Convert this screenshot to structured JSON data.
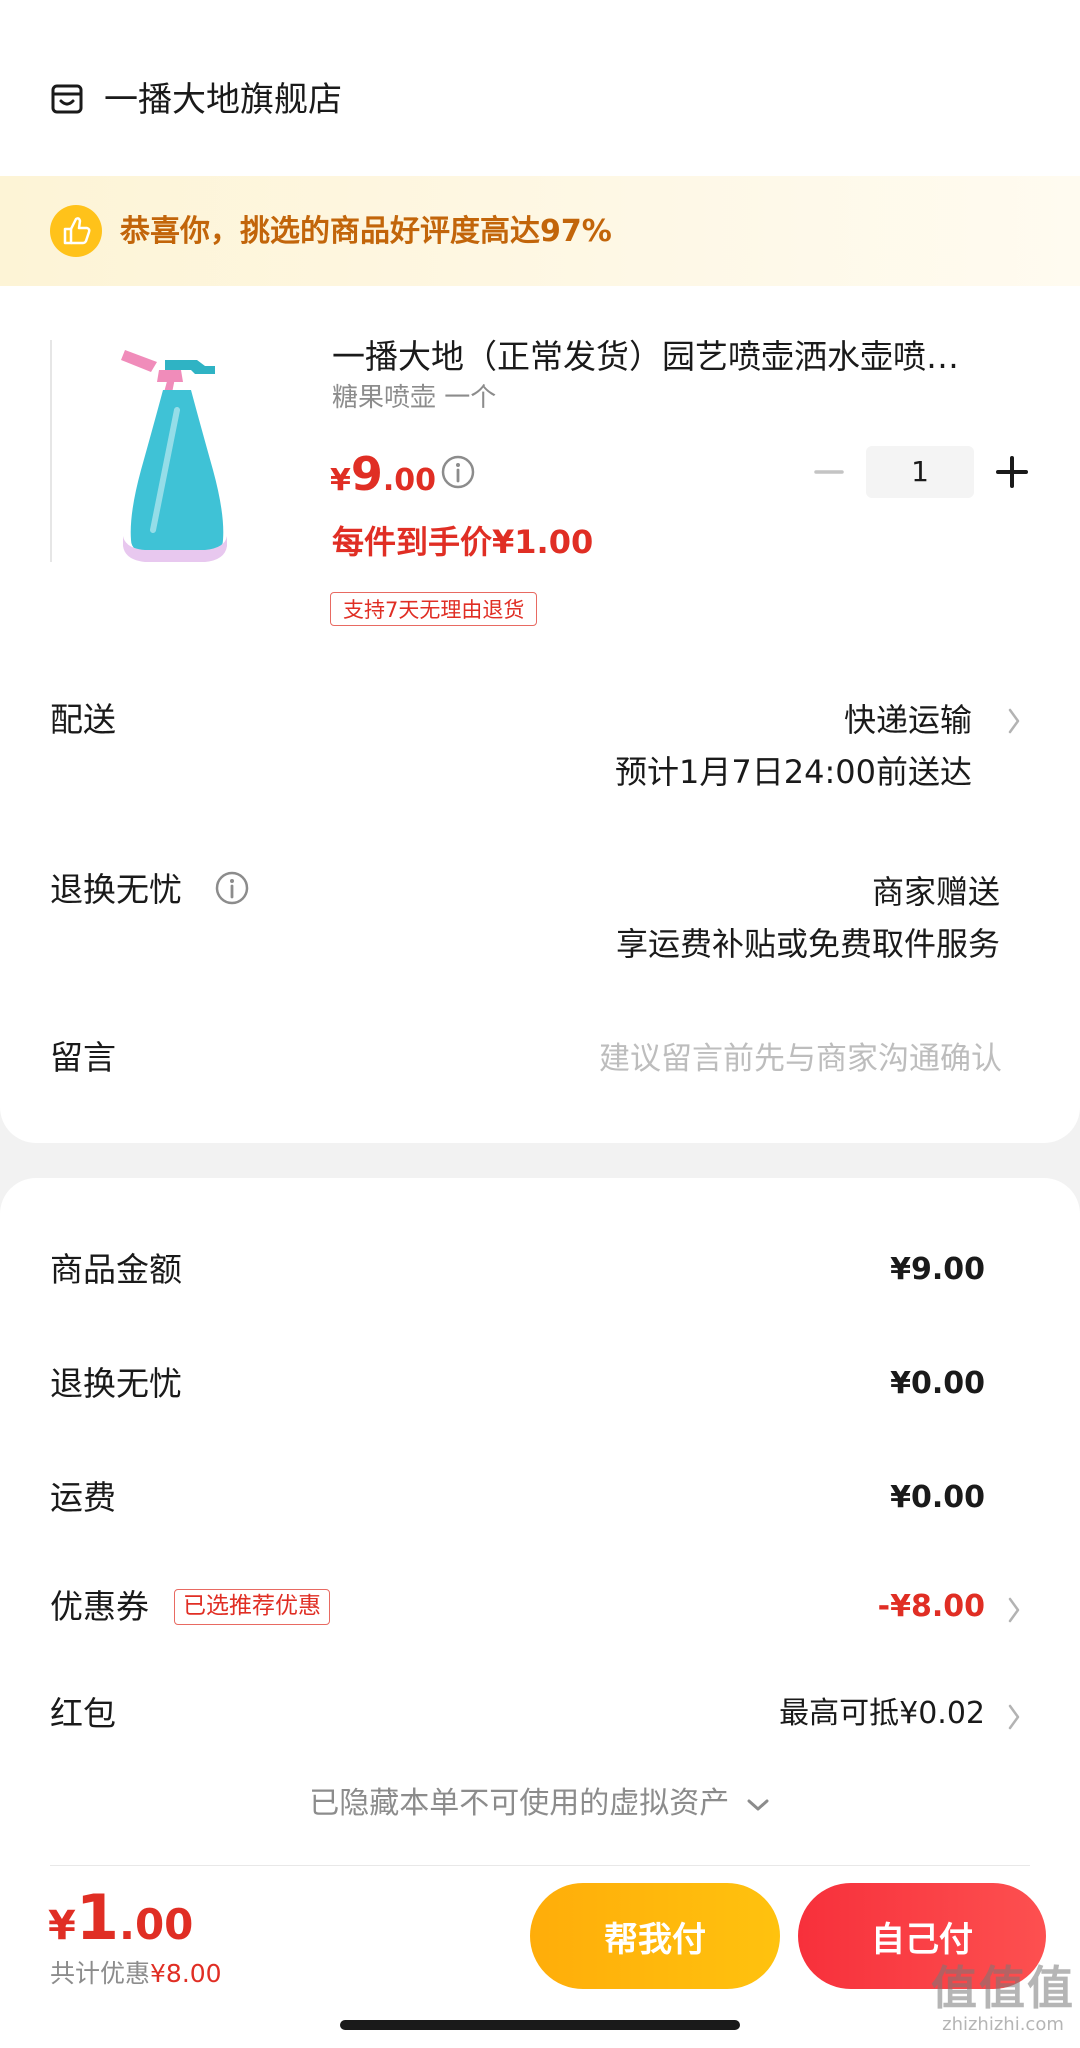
{
  "store": {
    "name": "一播大地旗舰店",
    "icon": "store-icon"
  },
  "banner": {
    "text": "恭喜你，挑选的商品好评度高达97%",
    "icon": "thumbs-up-icon"
  },
  "product": {
    "title": "一播大地（正常发货）园艺喷壶洒水壶喷…",
    "spec": "糖果喷壶 一个",
    "price_symbol": "¥",
    "price_int": "9",
    "price_dec": ".00",
    "quantity": "1",
    "unit_price": "每件到手价¥1.00",
    "return_badge": "支持7天无理由退货"
  },
  "delivery": {
    "label": "配送",
    "method": "快递运输",
    "eta": "预计1月7日24:00前送达"
  },
  "returns": {
    "label": "退换无忧",
    "value1": "商家赠送",
    "value2": "享运费补贴或免费取件服务"
  },
  "message": {
    "label": "留言",
    "placeholder": "建议留言前先与商家沟通确认"
  },
  "summary": {
    "goods_label": "商品金额",
    "goods_value": "¥9.00",
    "returns_label": "退换无忧",
    "returns_value": "¥0.00",
    "shipping_label": "运费",
    "shipping_value": "¥0.00",
    "coupon_label": "优惠券",
    "coupon_badge": "已选推荐优惠",
    "coupon_value": "-¥8.00",
    "redpacket_label": "红包",
    "redpacket_value": "最高可抵¥0.02",
    "hidden_assets": "已隐藏本单不可使用的虚拟资产"
  },
  "footer": {
    "total_symbol": "¥",
    "total_int": "1",
    "total_dec": ".00",
    "savings_label": "共计优惠",
    "savings_amount": "¥8.00",
    "help_pay": "帮我付",
    "self_pay": "自己付"
  },
  "watermark": {
    "line1": "值值值",
    "line2": "zhizhizhi.com"
  },
  "colors": {
    "accent_red": "#e02e24",
    "banner_text": "#c2650a",
    "help_button": "#ffb70c",
    "self_button": "#fa3e46"
  }
}
